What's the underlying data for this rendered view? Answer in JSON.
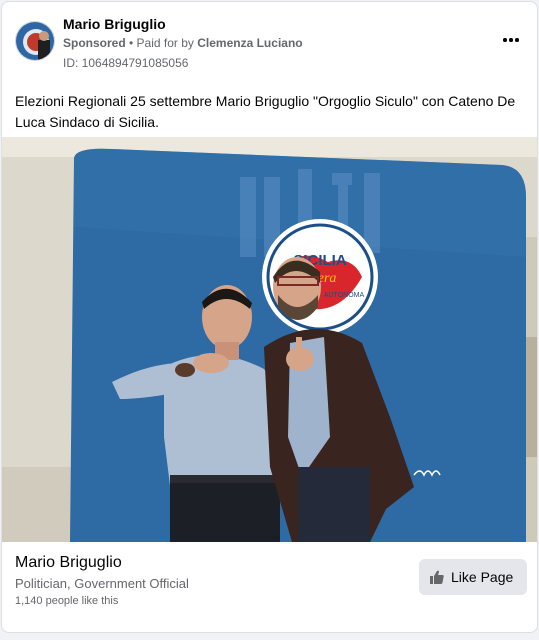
{
  "post": {
    "page_name": "Mario Briguglio",
    "sponsored_label": "Sponsored",
    "paid_for_prefix": " • Paid for by ",
    "paid_for_by": "Clemenza Luciano",
    "ad_id": "ID: 1064894791085056",
    "text": "Elezioni Regionali 25 settembre Mario Briguglio \"Orgoglio Siculo\" con Cateno De Luca Sindaco di Sicilia.",
    "more_icon": "more-horizontal-icon"
  },
  "photo": {
    "logo_text": "SICILIA",
    "logo_subtext": "vera",
    "logo_ring_text": "AUTONOMA"
  },
  "footer": {
    "page_name": "Mario Briguglio",
    "category": "Politician, Government Official",
    "likes": "1,140 people like this",
    "like_button_label": "Like Page",
    "like_icon": "thumbs-up-icon"
  },
  "colors": {
    "backdrop_blue": "#2e6aa3",
    "button_gray": "#e4e6eb",
    "secondary_text": "#65676b"
  }
}
